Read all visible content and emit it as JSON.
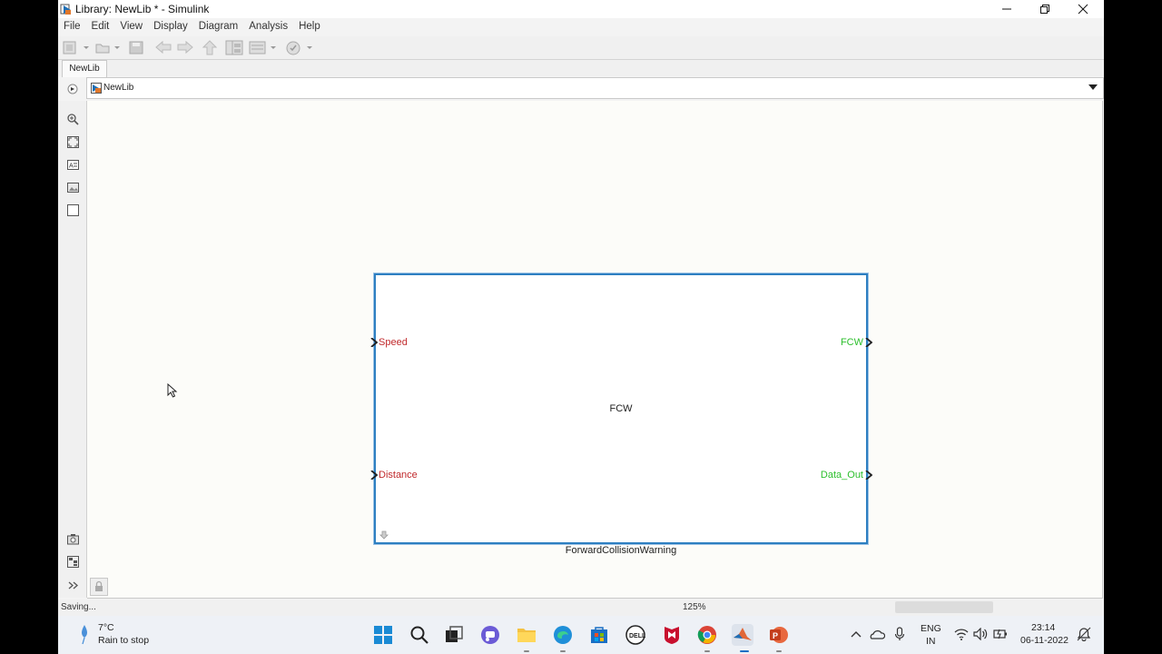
{
  "window": {
    "title": "Library: NewLib * - Simulink"
  },
  "menu": [
    "File",
    "Edit",
    "View",
    "Display",
    "Diagram",
    "Analysis",
    "Help"
  ],
  "tab": {
    "label": "NewLib"
  },
  "address": {
    "path": "NewLib"
  },
  "block": {
    "title": "FCW",
    "name": "ForwardCollisionWarning",
    "inputs": [
      "Speed",
      "Distance"
    ],
    "outputs": [
      "FCW",
      "Data_Out"
    ]
  },
  "status": {
    "left": "Saving...",
    "zoom": "125%"
  },
  "taskbar": {
    "weather_temp": "7°C",
    "weather_desc": "Rain to stop",
    "lang_line1": "ENG",
    "lang_line2": "IN",
    "time": "23:14",
    "date": "06-11-2022"
  },
  "colors": {
    "input_port": "#c0282b",
    "output_port": "#2cbf2c",
    "selection": "#2d7fc1"
  },
  "icons": {
    "palette": [
      "zoom-icon",
      "fit-view-icon",
      "annotation-icon",
      "image-icon",
      "area-icon",
      "screenshot-icon",
      "model-browser-icon",
      "expand-icon"
    ],
    "taskbar": [
      "windows-start-icon",
      "search-icon",
      "task-view-icon",
      "chat-icon",
      "file-explorer-icon",
      "edge-icon",
      "store-icon",
      "dell-icon",
      "mcafee-icon",
      "chrome-icon",
      "matlab-icon",
      "powerpoint-icon"
    ]
  }
}
